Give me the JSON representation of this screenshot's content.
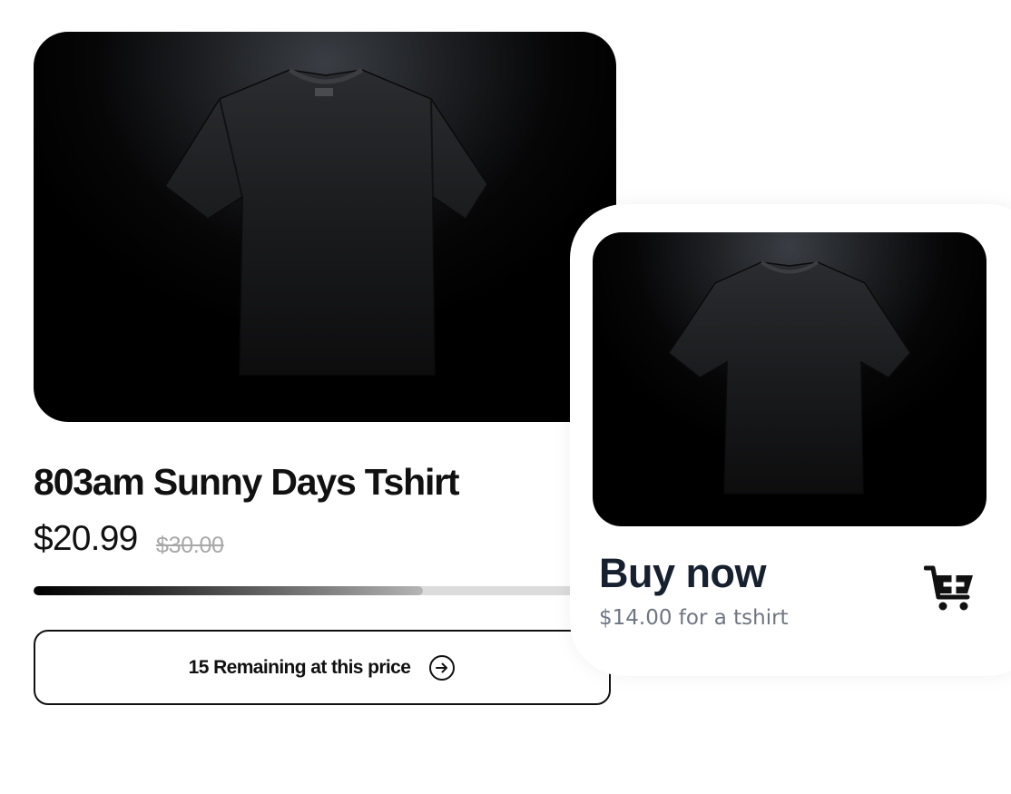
{
  "product": {
    "title": "803am Sunny Days Tshirt",
    "price": "$20.99",
    "original_price": "$30.00",
    "stock_progress_percent": 67,
    "remaining_label": "15 Remaining at this price",
    "image_icon": "black-tshirt-image",
    "arrow_icon": "arrow-right-circle-icon"
  },
  "buy_card": {
    "title": "Buy now",
    "subtitle": "$14.00 for a tshirt",
    "cart_icon": "cart-add-icon"
  },
  "colors": {
    "text_primary": "#111111",
    "buy_title": "#17202e",
    "muted": "#6f7682",
    "strikethrough": "#a8a8a8",
    "progress_track": "#dcdcdc"
  }
}
